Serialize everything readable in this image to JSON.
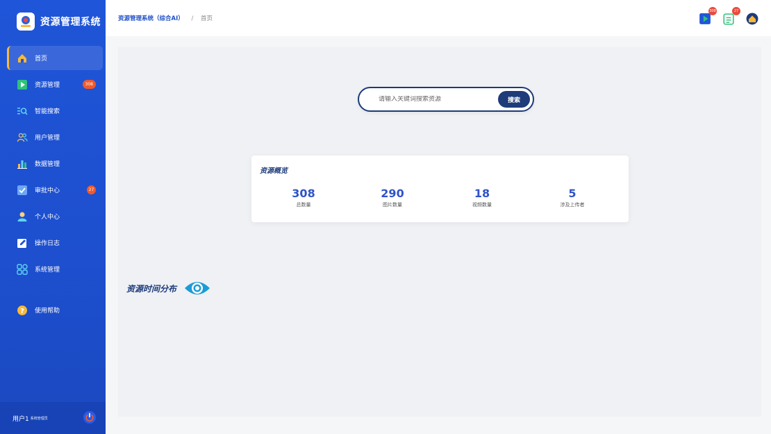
{
  "app": {
    "title": "资源管理系统"
  },
  "sidebar": {
    "items": [
      {
        "label": "首页",
        "icon": "home-icon",
        "active": true
      },
      {
        "label": "资源管理",
        "icon": "play-icon",
        "badge": "308"
      },
      {
        "label": "智能搜索",
        "icon": "search-list-icon"
      },
      {
        "label": "用户管理",
        "icon": "users-icon"
      },
      {
        "label": "数据管理",
        "icon": "bar-chart-icon"
      },
      {
        "label": "审批中心",
        "icon": "check-shield-icon",
        "badge": "27"
      },
      {
        "label": "个人中心",
        "icon": "person-icon"
      },
      {
        "label": "操作日志",
        "icon": "edit-icon"
      },
      {
        "label": "系统管理",
        "icon": "grid-icon"
      },
      {
        "label": "使用帮助",
        "icon": "help-icon"
      }
    ]
  },
  "user": {
    "name": "用户1",
    "role": "系统管理员"
  },
  "header": {
    "breadcrumb_root": "资源管理系统（综合AI）",
    "breadcrumb_sep": "/",
    "breadcrumb_current": "首页",
    "icon_badges": {
      "resources": "308",
      "approvals": "27"
    }
  },
  "search": {
    "placeholder": "请输入关键词搜索资源",
    "button": "搜索"
  },
  "overview": {
    "title": "资源概览",
    "stats": [
      {
        "value": "308",
        "label": "总数量"
      },
      {
        "value": "290",
        "label": "图片数量"
      },
      {
        "value": "18",
        "label": "视频数量"
      },
      {
        "value": "5",
        "label": "涉及上传者"
      }
    ]
  },
  "distribution": {
    "title": "资源时间分布"
  },
  "colors": {
    "sidebar": "#1f55d8",
    "accent": "#f6b93b",
    "badge": "#f0592b",
    "primary_text": "#1e3b7a",
    "stat": "#2f54c8"
  }
}
